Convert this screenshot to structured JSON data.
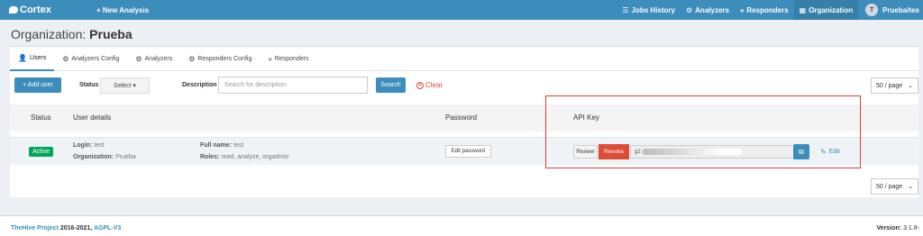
{
  "topbar": {
    "brand": "Cortex",
    "new_analysis": "+ New Analysis",
    "nav": [
      {
        "label": "Jobs History",
        "icon": "list-icon"
      },
      {
        "label": "Analyzers",
        "icon": "cogs-icon"
      },
      {
        "label": "Responders",
        "icon": "fast-forward-icon"
      },
      {
        "label": "Organization",
        "icon": "building-icon",
        "active": true
      }
    ],
    "user_initial": "T",
    "user_label": "Prueba/tes"
  },
  "page": {
    "title_prefix": "Organization: ",
    "org_name": "Prueba"
  },
  "tabs": [
    {
      "label": "Users",
      "icon": "user-icon",
      "active": true
    },
    {
      "label": "Analyzers Config",
      "icon": "cog-icon"
    },
    {
      "label": "Analyzers",
      "icon": "cogs-icon"
    },
    {
      "label": "Responders Config",
      "icon": "cog-icon"
    },
    {
      "label": "Responders",
      "icon": "fast-forward-icon"
    }
  ],
  "filters": {
    "add_user": "+ Add user",
    "status_label": "Status",
    "status_select": "Select ▾",
    "description_label": "Description",
    "description_placeholder": "Search for description",
    "search": "Search",
    "clear": "Clear",
    "per_page": "50 / page"
  },
  "table": {
    "headers": {
      "status": "Status",
      "user_details": "User details",
      "password": "Password",
      "api_key": "API Key"
    },
    "rows": [
      {
        "status": "Active",
        "login_label": "Login:",
        "login": "test",
        "org_label": "Organization:",
        "org": "Prueba",
        "fullname_label": "Full name:",
        "fullname": "test",
        "roles_label": "Roles:",
        "roles": "read, analyze, orgadmin",
        "edit_password": "Edit password",
        "renew": "Renew",
        "revoke": "Revoke",
        "api_key_visible": "g2",
        "edit": "Edit"
      }
    ]
  },
  "footer": {
    "project": "TheHive Project",
    "years": " 2016-2021, ",
    "license": "AGPL-V3",
    "version_label": "Version:",
    "version": " 3.1.8-"
  },
  "colors": {
    "primary": "#3c8dbc",
    "danger": "#dd4b39",
    "success": "#00a65a",
    "highlight": "#e53935"
  }
}
